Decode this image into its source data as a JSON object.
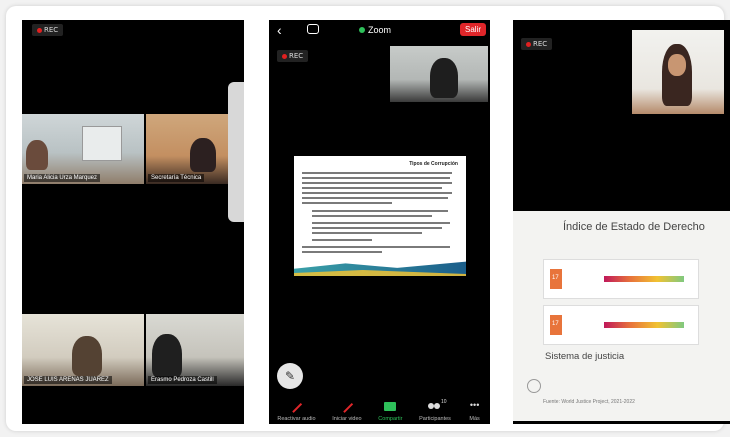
{
  "rec_label": "REC",
  "panel1": {
    "participants": [
      {
        "name": "Maria Alicia Urza Marquez"
      },
      {
        "name": "Secretaría Técnica"
      },
      {
        "name": "JOSE LUIS ARENAS JUAREZ"
      },
      {
        "name": "Erasmo Pedroza Castill"
      }
    ]
  },
  "panel2": {
    "app_title": "Zoom",
    "exit_button": "Salir",
    "document_title": "Tipos de Corrupción",
    "toolbar": [
      {
        "label": "Reactivar audio",
        "icon": "microphone-muted-icon"
      },
      {
        "label": "Iniciar video",
        "icon": "video-off-icon"
      },
      {
        "label": "Compartir",
        "icon": "share-screen-icon",
        "active": true
      },
      {
        "label": "Participantes",
        "icon": "participants-icon",
        "count": "10"
      },
      {
        "label": "Más",
        "icon": "more-icon"
      }
    ]
  },
  "panel3": {
    "slide_title": "Índice de Estado de Derecho",
    "slide_subtitle": "Sistema de justicia",
    "card_badges": [
      "17",
      "17"
    ],
    "footer_text": "Fuente: World Justice Project, 2021-2022"
  },
  "colors": {
    "exit": "#e0262a",
    "active": "#2ec05a"
  }
}
